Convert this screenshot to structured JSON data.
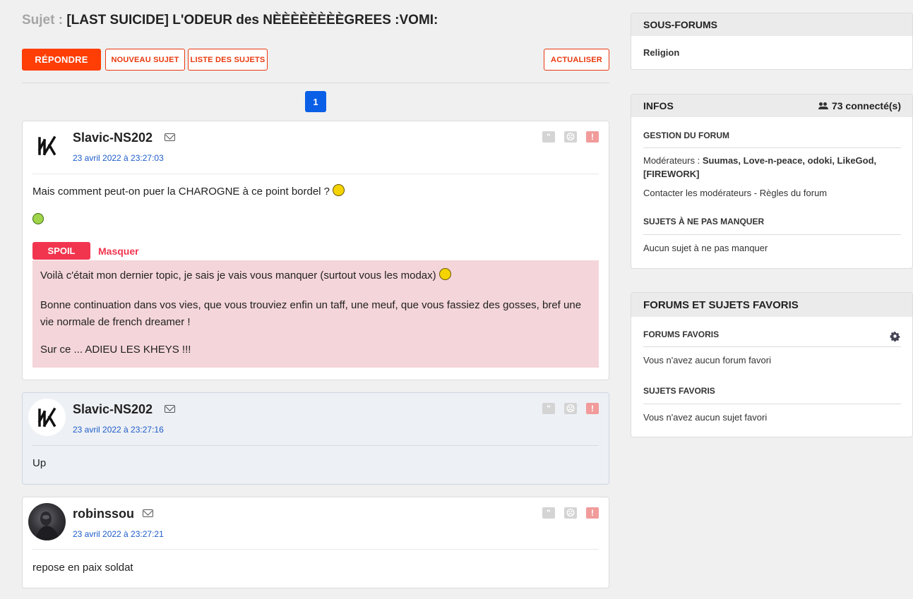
{
  "topic": {
    "prefix": "Sujet :",
    "title": "[LAST SUICIDE] L'ODEUR des NÈÈÈÈÈÈÈÈGREES :VOMI:"
  },
  "toolbar": {
    "reply": "RÉPONDRE",
    "new_topic": "NOUVEAU SUJET",
    "topic_list": "LISTE DES SUJETS",
    "refresh": "ACTUALISER"
  },
  "pagination": {
    "current": "1"
  },
  "posts": [
    {
      "author": "Slavic-NS202",
      "date": "23 avril 2022 à 23:27:03",
      "text": "Mais comment peut-on puer la CHAROGNE à ce point bordel ?",
      "spoil_label": "SPOIL",
      "spoil_hide": "Masquer",
      "spoil_lines": [
        "Voilà c'était mon dernier topic, je sais je vais vous manquer (surtout vous les modax)",
        "Bonne continuation dans vos vies, que vous trouviez enfin un taff, une meuf, que vous fassiez des gosses, bref une vie normale de french dreamer !",
        "Sur ce ... ADIEU LES KHEYS !!!"
      ]
    },
    {
      "author": "Slavic-NS202",
      "date": "23 avril 2022 à 23:27:16",
      "text": "Up"
    },
    {
      "author": "robinssou",
      "date": "23 avril 2022 à 23:27:21",
      "text": "repose en paix soldat"
    }
  ],
  "sidebar": {
    "subforums": {
      "title": "SOUS-FORUMS",
      "items": [
        "Religion"
      ]
    },
    "infos": {
      "title": "INFOS",
      "online": "73 connecté(s)",
      "management_title": "GESTION DU FORUM",
      "moderators_label": "Modérateurs :",
      "moderators": "Suumas, Love-n-peace, odoki, LikeGod, [FIREWORK]",
      "contact": "Contacter les modérateurs",
      "rules": "Règles du forum",
      "rules_sep": " - ",
      "must_see_title": "SUJETS À NE PAS MANQUER",
      "must_see_text": "Aucun sujet à ne pas manquer"
    },
    "favorites": {
      "title": "FORUMS ET SUJETS FAVORIS",
      "forums_title": "FORUMS FAVORIS",
      "forums_text": "Vous n'avez aucun forum favori",
      "topics_title": "SUJETS FAVORIS",
      "topics_text": "Vous n'avez aucun sujet favori"
    }
  }
}
